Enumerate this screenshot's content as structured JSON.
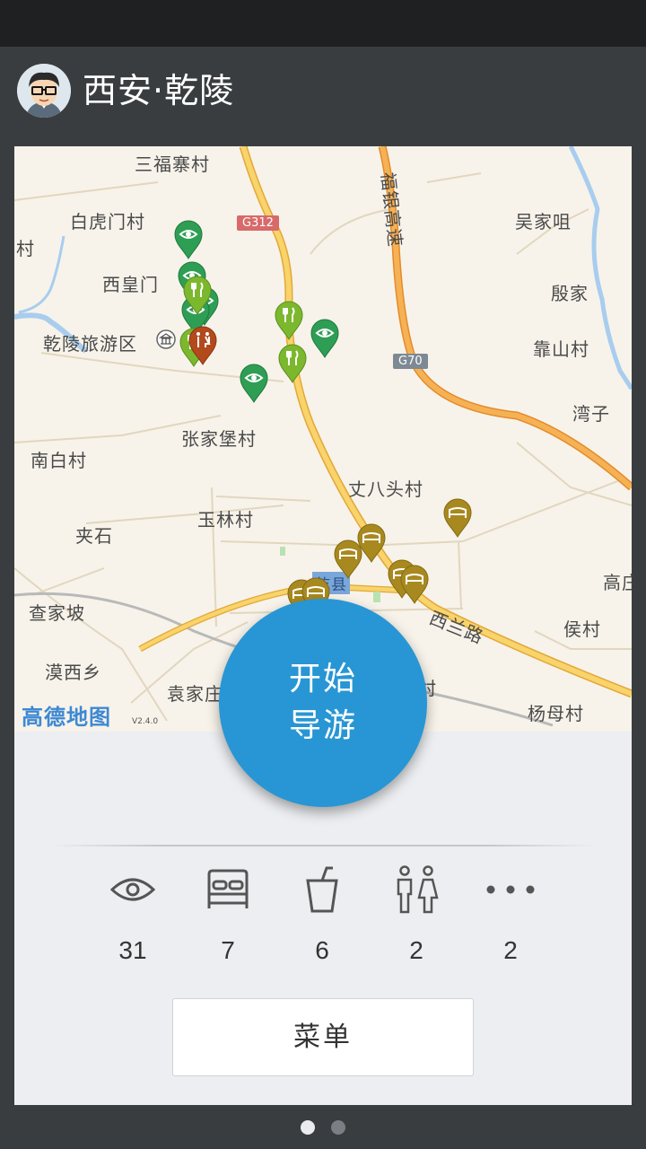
{
  "app": {
    "title": "西安·乾陵"
  },
  "map": {
    "labels": {
      "sanfuzhai": "三福寨村",
      "baihumen": "白虎门村",
      "cun": "村",
      "xihuangmen": "西皇门",
      "qianling_area": "乾陵旅游区",
      "zhangjiapu": "张家堡村",
      "nanbai": "南白村",
      "yulin": "玉林村",
      "jiashi": "夹石",
      "chajiapo": "查家坡",
      "moxixiang": "漠西乡",
      "yuanjia": "袁家庄",
      "wujiazui": "吴家咀",
      "yinjia": "殷家",
      "kaoshan": "靠山村",
      "wanzi": "湾子",
      "zhangbatou": "丈八头村",
      "gao": "高庄",
      "houcun": "侯村",
      "yangmu": "杨母村",
      "cun2": "村",
      "xilan_road": "西兰路",
      "fuyin_expressway": "福银高速",
      "qian_county": "乾县"
    },
    "road_badges": {
      "g312": "G312",
      "g70": "G70"
    },
    "provider": "高德地图",
    "version": "V2.4.0"
  },
  "start_button": {
    "line1": "开始",
    "line2": "导游"
  },
  "categories": [
    {
      "icon": "eye-icon",
      "count": "31"
    },
    {
      "icon": "bed-icon",
      "count": "7"
    },
    {
      "icon": "drink-cup-icon",
      "count": "6"
    },
    {
      "icon": "restroom-icon",
      "count": "2"
    },
    {
      "icon": "more-dots-icon",
      "count": "2"
    }
  ],
  "menu_button": {
    "label": "菜单"
  },
  "colors": {
    "app_bar": "#3a3d40",
    "accent": "#2896d4",
    "pin_sight": "#2f9e55",
    "pin_food": "#7bb82e",
    "pin_hotel": "#a8891f",
    "pin_toilet": "#b24a1c"
  }
}
